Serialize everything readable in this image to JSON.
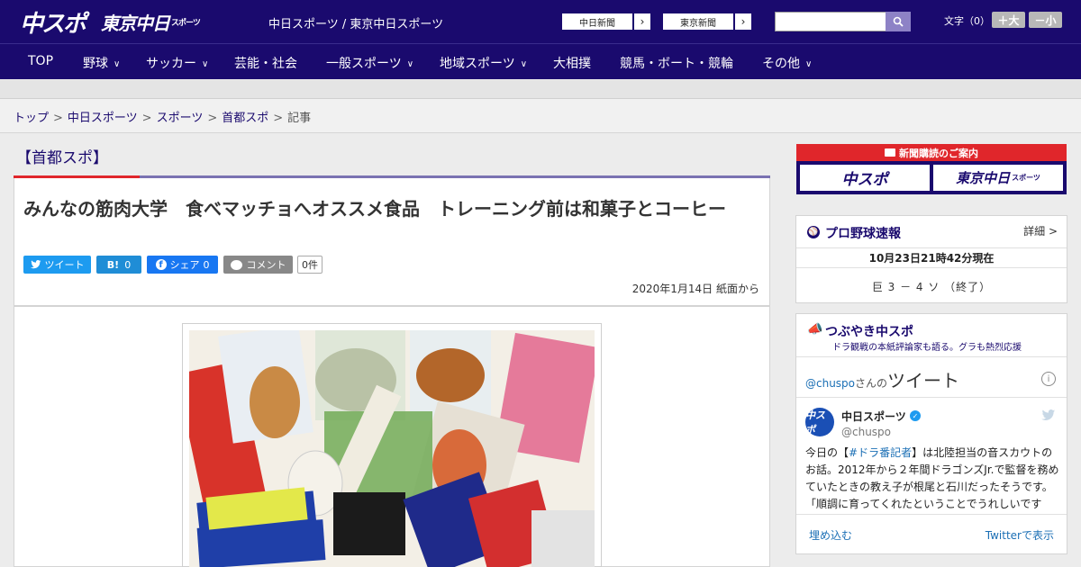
{
  "header": {
    "logo_chuspo": "中スポ",
    "logo_tokyo": "東京中日",
    "logo_tokyo_suffix": "スポーツ",
    "site_name": "中日スポーツ / 東京中日スポーツ",
    "ext_links": [
      {
        "label": "中日新聞"
      },
      {
        "label": "東京新聞"
      }
    ],
    "search_placeholder": "",
    "font_size_label": "文字（0）",
    "font_plus": "＋大",
    "font_minus": "－小",
    "brand_color": "#1a0a6e"
  },
  "nav": {
    "items": [
      {
        "label": "TOP"
      },
      {
        "label": "野球"
      },
      {
        "label": "サッカー"
      },
      {
        "label": "芸能・社会"
      },
      {
        "label": "一般スポーツ"
      },
      {
        "label": "地域スポーツ"
      },
      {
        "label": "大相撲"
      },
      {
        "label": "競馬・ボート・競輪"
      },
      {
        "label": "その他"
      }
    ]
  },
  "breadcrumb": {
    "items": [
      "トップ",
      "中日スポーツ",
      "スポーツ",
      "首都スポ",
      "記事"
    ],
    "separator": ">"
  },
  "section": {
    "title": "【首都スポ】"
  },
  "article": {
    "title": "みんなの筋肉大学　食べマッチョへオススメ食品　トレーニング前は和菓子とコーヒー",
    "share": {
      "tweet": "ツイート",
      "hatena_icon": "B!",
      "hatena_count": "0",
      "fb": "シェア",
      "fb_count": "0",
      "comment": "コメント",
      "comment_count": "0件"
    },
    "date": "2020年1月14日 紙面から"
  },
  "sidebar": {
    "subscribe": {
      "banner": "新聞購読のご案内",
      "left": "中スポ",
      "right": "東京中日",
      "right_suffix": "スポーツ"
    },
    "baseball": {
      "title": "プロ野球速報",
      "detail": "詳細 >",
      "time": "10月23日21時42分現在",
      "score": "巨 3 － 4 ソ （終了）"
    },
    "tweets": {
      "title": "つぶやき中スポ",
      "subtitle": "ドラ観戦の本紙評論家も語る。グラも熱烈応援",
      "handle": "@chuspo",
      "handle_suffix": "さんの",
      "heading": "ツイート",
      "info": "i",
      "user_name": "中日スポーツ",
      "user_handle": "@chuspo",
      "avatar_text": "中スポ",
      "text_pre": "今日の【",
      "text_tag": "#ドラ番記者",
      "text_post": "】は北陸担当の音スカウトのお話。2012年から２年間ドラゴンズJr.で監督を務めていたときの教え子が根尾と石川だったそうです。「順調に育ってくれたということでうれしいです",
      "embed": "埋め込む",
      "view": "Twitterで表示"
    }
  }
}
